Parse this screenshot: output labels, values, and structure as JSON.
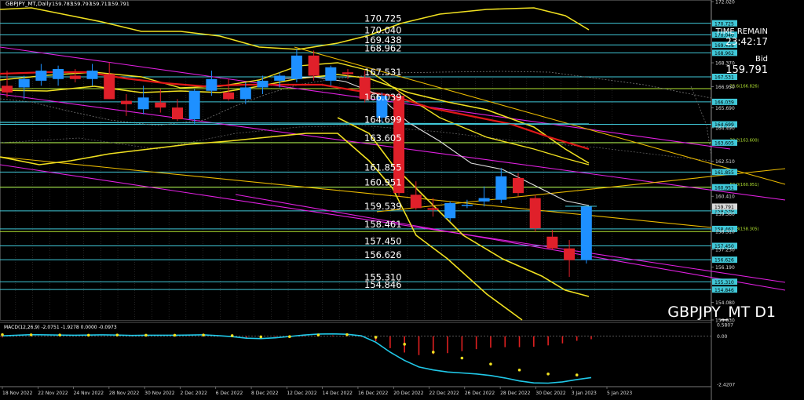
{
  "chart_data": {
    "type": "candlestick",
    "header": {
      "symbol_timeframe": "GBPJPY_MT,Daily",
      "ohlc": [
        "159.783",
        "159.797",
        "159.711",
        "159.791"
      ]
    },
    "watermark": "GBPJPY_MT D1",
    "time_remain": {
      "label": "TIME REMAIN",
      "value": "23:42:17"
    },
    "bid": {
      "label": "Bid",
      "value": "159.791"
    },
    "ylim": [
      153.03,
      172.02
    ],
    "price_axis_ticks": [
      "172.020",
      "170.725",
      "170.040",
      "169.438",
      "168.962",
      "167.531",
      "166.039",
      "164.699",
      "163.605",
      "161.855",
      "160.951",
      "159.539",
      "158.461",
      "157.450",
      "156.626",
      "155.310",
      "154.846",
      "154.080",
      "153.030",
      "168.370",
      "166.950",
      "165.690",
      "164.490",
      "162.510",
      "160.410",
      "159.360",
      "158.310",
      "157.230",
      "156.190"
    ],
    "price_axis_numbers": [
      172.02,
      170.725,
      170.04,
      169.438,
      168.962,
      167.531,
      166.039,
      164.699,
      163.605,
      161.855,
      160.951,
      159.539,
      158.461,
      157.45,
      156.626,
      155.31,
      154.846,
      154.08,
      153.03,
      168.37,
      166.95,
      165.69,
      164.49,
      162.51,
      160.41,
      159.36,
      158.31,
      157.23,
      156.19
    ],
    "levels": [
      {
        "label": "170.725",
        "value": 170.725,
        "color": "#40c8d8"
      },
      {
        "label": "170.040",
        "value": 170.04,
        "color": "#40c8d8"
      },
      {
        "label": "169.438",
        "value": 169.438,
        "color": "#40c8d8"
      },
      {
        "label": "168.962",
        "value": 168.962,
        "color": "#40c8d8"
      },
      {
        "label": "167.531",
        "value": 167.531,
        "color": "#40c8d8"
      },
      {
        "label": "166.039",
        "value": 166.039,
        "color": "#40c8d8"
      },
      {
        "label": "164.699",
        "value": 164.699,
        "color": "#40c8d8"
      },
      {
        "label": "163.605",
        "value": 163.605,
        "color": "#40c8d8"
      },
      {
        "label": "161.855",
        "value": 161.855,
        "color": "#40c8d8"
      },
      {
        "label": "160.951",
        "value": 160.951,
        "color": "#40c8d8"
      },
      {
        "label": "159.539",
        "value": 159.539,
        "color": "#40c8d8"
      },
      {
        "label": "158.461",
        "value": 158.461,
        "color": "#40c8d8"
      },
      {
        "label": "157.450",
        "value": 157.45,
        "color": "#40c8d8"
      },
      {
        "label": "156.626",
        "value": 156.626,
        "color": "#40c8d8"
      },
      {
        "label": "155.310",
        "value": 155.31,
        "color": "#40c8d8"
      },
      {
        "label": "154.846",
        "value": 154.846,
        "color": "#40c8d8"
      }
    ],
    "fib_levels": [
      {
        "label": "23.6(166.826)",
        "value": 166.826
      },
      {
        "label": "38.2(163.600)",
        "value": 163.6
      },
      {
        "label": "50.0(160.951)",
        "value": 160.951
      },
      {
        "label": "61.8(158.305)",
        "value": 158.305
      }
    ],
    "date_labels": [
      "18 Nov 2022",
      "22 Nov 2022",
      "24 Nov 2022",
      "28 Nov 2022",
      "30 Nov 2022",
      "2 Dec 2022",
      "6 Dec 2022",
      "8 Dec 2022",
      "12 Dec 2022",
      "14 Dec 2022",
      "16 Dec 2022",
      "20 Dec 2022",
      "22 Dec 2022",
      "26 Dec 2022",
      "28 Dec 2022",
      "30 Dec 2022",
      "3 Jan 2023",
      "5 Jan 2023"
    ],
    "candles": [
      {
        "o": 167.0,
        "h": 167.9,
        "l": 166.3,
        "c": 166.6
      },
      {
        "o": 166.9,
        "h": 167.6,
        "l": 166.2,
        "c": 167.4
      },
      {
        "o": 167.3,
        "h": 168.3,
        "l": 167.0,
        "c": 167.9
      },
      {
        "o": 167.4,
        "h": 168.2,
        "l": 167.0,
        "c": 168.0
      },
      {
        "o": 167.6,
        "h": 168.0,
        "l": 167.2,
        "c": 167.4
      },
      {
        "o": 167.4,
        "h": 168.3,
        "l": 167.0,
        "c": 167.9
      },
      {
        "o": 167.7,
        "h": 168.4,
        "l": 166.2,
        "c": 166.2
      },
      {
        "o": 166.1,
        "h": 166.5,
        "l": 165.2,
        "c": 165.9
      },
      {
        "o": 165.6,
        "h": 167.0,
        "l": 165.3,
        "c": 166.3
      },
      {
        "o": 166.0,
        "h": 166.8,
        "l": 165.4,
        "c": 165.7
      },
      {
        "o": 165.7,
        "h": 166.2,
        "l": 164.9,
        "c": 165.0
      },
      {
        "o": 165.0,
        "h": 166.8,
        "l": 164.7,
        "c": 166.7
      },
      {
        "o": 166.7,
        "h": 167.9,
        "l": 166.4,
        "c": 167.4
      },
      {
        "o": 166.6,
        "h": 167.4,
        "l": 166.1,
        "c": 166.2
      },
      {
        "o": 166.2,
        "h": 167.2,
        "l": 165.9,
        "c": 166.9
      },
      {
        "o": 166.9,
        "h": 167.6,
        "l": 166.5,
        "c": 167.3
      },
      {
        "o": 167.3,
        "h": 167.8,
        "l": 166.9,
        "c": 167.6
      },
      {
        "o": 167.4,
        "h": 169.2,
        "l": 167.2,
        "c": 168.8
      },
      {
        "o": 168.8,
        "h": 169.1,
        "l": 167.3,
        "c": 167.6
      },
      {
        "o": 167.3,
        "h": 168.2,
        "l": 167.0,
        "c": 168.1
      },
      {
        "o": 167.8,
        "h": 168.0,
        "l": 167.4,
        "c": 167.7
      },
      {
        "o": 167.5,
        "h": 167.9,
        "l": 166.0,
        "c": 166.2
      },
      {
        "o": 165.1,
        "h": 166.6,
        "l": 164.8,
        "c": 166.4
      },
      {
        "o": 166.4,
        "h": 166.7,
        "l": 160.4,
        "c": 160.6
      },
      {
        "o": 160.5,
        "h": 161.3,
        "l": 159.6,
        "c": 159.7
      },
      {
        "o": 159.7,
        "h": 160.3,
        "l": 159.2,
        "c": 159.6
      },
      {
        "o": 159.1,
        "h": 160.1,
        "l": 158.9,
        "c": 160.0
      },
      {
        "o": 159.9,
        "h": 160.2,
        "l": 159.7,
        "c": 159.9
      },
      {
        "o": 160.1,
        "h": 161.0,
        "l": 159.8,
        "c": 160.3
      },
      {
        "o": 160.2,
        "h": 162.1,
        "l": 160.0,
        "c": 161.6
      },
      {
        "o": 161.5,
        "h": 161.8,
        "l": 160.4,
        "c": 160.6
      },
      {
        "o": 160.3,
        "h": 160.5,
        "l": 158.3,
        "c": 158.5
      },
      {
        "o": 158.0,
        "h": 158.4,
        "l": 157.2,
        "c": 157.3
      },
      {
        "o": 157.3,
        "h": 157.8,
        "l": 155.6,
        "c": 156.6
      },
      {
        "o": 156.6,
        "h": 159.8,
        "l": 156.4,
        "c": 159.791
      }
    ],
    "colors": {
      "up": "#1e90ff",
      "down": "#e0202a",
      "level": "#40c8d8",
      "fib": "#b4e632",
      "channel": "#e020e0",
      "trend": "#e8b800",
      "bands": "#f0e020",
      "ma_red": "#e01818",
      "ma_white": "#e0e0e0",
      "macd_line": "#20c8e8",
      "macd_signal": "#f0e020",
      "macd_hist": "#e02020"
    },
    "macd": {
      "label": "MACD(12,26,9) -2.0751 -1.9278 0.0000 -0.0973",
      "ylim": [
        -2.5,
        0.62
      ],
      "axis_ticks": [
        "0.5807",
        "0.00",
        "-2.4207"
      ],
      "axis_numbers": [
        0.5807,
        0.0,
        -2.4207
      ],
      "main": [
        0.02,
        0.05,
        0.08,
        0.07,
        0.06,
        0.05,
        0.06,
        0.07,
        0.06,
        0.04,
        0.05,
        0.05,
        0.05,
        0.06,
        0.07,
        0.03,
        -0.02,
        -0.1,
        -0.12,
        -0.08,
        -0.01,
        0.06,
        0.11,
        0.12,
        0.1,
        0.02,
        -0.3,
        -0.8,
        -1.22,
        -1.55,
        -1.7,
        -1.8,
        -1.85,
        -1.9,
        -1.98,
        -2.1,
        -2.25,
        -2.35,
        -2.36,
        -2.3,
        -2.18,
        -2.08
      ],
      "signal": [
        0.08,
        0.07,
        0.07,
        0.06,
        0.06,
        0.05,
        0.05,
        0.06,
        0.06,
        0.05,
        0.05,
        0.05,
        0.05,
        0.05,
        0.06,
        0.05,
        0.03,
        -0.01,
        -0.03,
        -0.04,
        -0.02,
        0.02,
        0.06,
        0.08,
        0.08,
        0.06,
        -0.05,
        -0.2,
        -0.4,
        -0.6,
        -0.8,
        -0.95,
        -1.1,
        -1.25,
        -1.4,
        -1.55,
        -1.7,
        -1.82,
        -1.9,
        -1.94,
        -1.95,
        -1.93
      ],
      "hist": [
        -0.06,
        -0.02,
        0.01,
        0.01,
        0.0,
        0.0,
        0.01,
        0.01,
        0.0,
        -0.01,
        0.0,
        0.0,
        0.0,
        0.01,
        0.01,
        -0.02,
        -0.05,
        -0.09,
        -0.09,
        -0.04,
        0.01,
        0.04,
        0.05,
        0.04,
        0.02,
        -0.04,
        -0.25,
        -0.6,
        -0.82,
        -0.95,
        -0.9,
        -0.85,
        -0.75,
        -0.65,
        -0.58,
        -0.55,
        -0.55,
        -0.53,
        -0.46,
        -0.36,
        -0.23,
        -0.15
      ]
    }
  }
}
